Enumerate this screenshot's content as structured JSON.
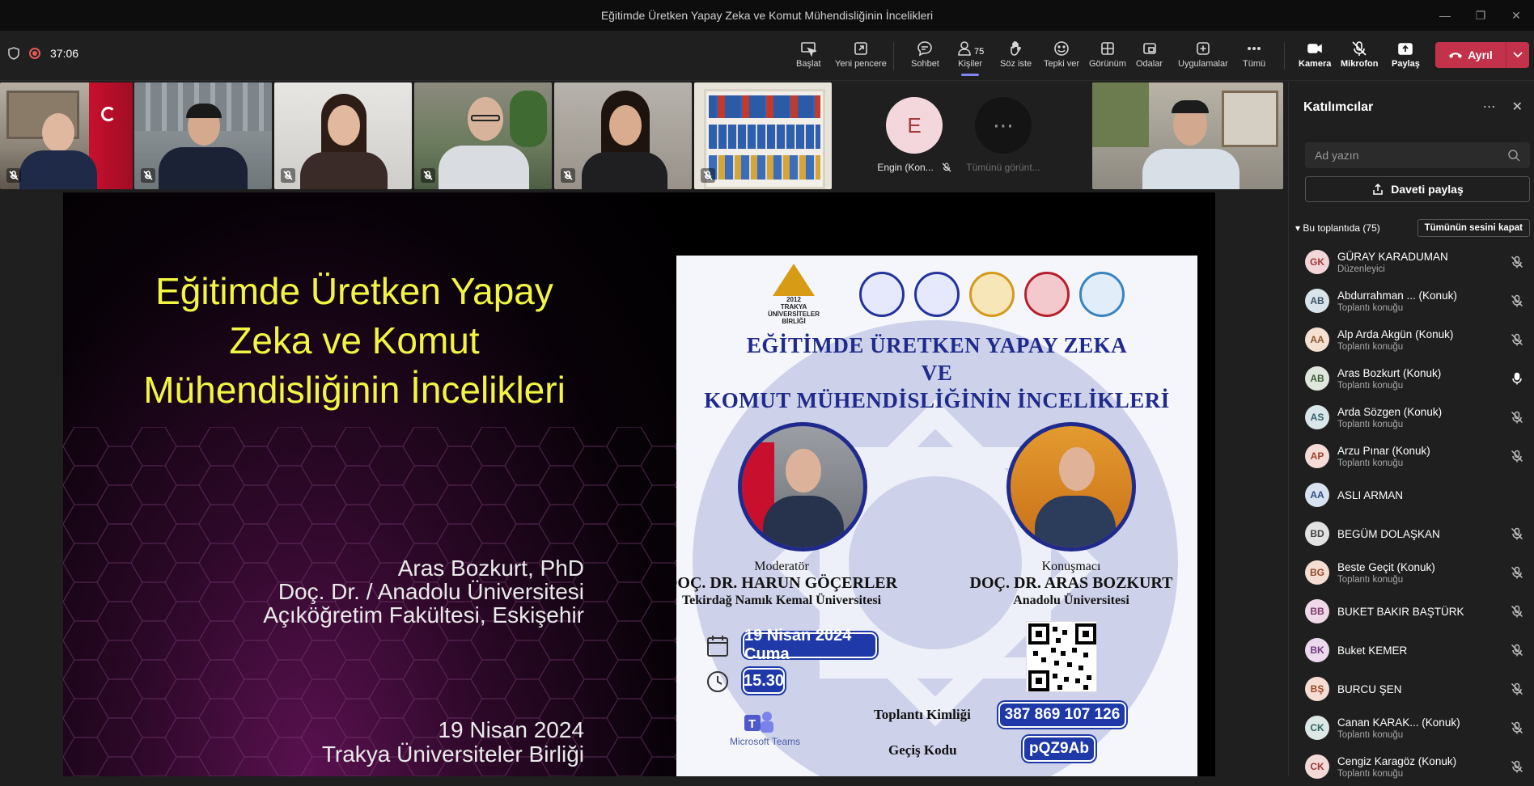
{
  "window": {
    "title": "Eğitimde Üretken Yapay Zeka ve Komut Mühendisliğinin İncelikleri"
  },
  "meeting": {
    "timer": "37:06"
  },
  "toolbar": {
    "items": [
      {
        "label": "Başlat",
        "icon": "present-cursor-icon"
      },
      {
        "label": "Yeni pencere",
        "icon": "new-window-icon"
      },
      {
        "label": "Sohbet",
        "icon": "chat-icon"
      },
      {
        "label": "Kişiler",
        "icon": "people-icon",
        "count": "75"
      },
      {
        "label": "Söz iste",
        "icon": "raise-hand-icon"
      },
      {
        "label": "Tepki ver",
        "icon": "react-emoji-icon"
      },
      {
        "label": "Görünüm",
        "icon": "view-grid-icon"
      },
      {
        "label": "Odalar",
        "icon": "rooms-icon"
      },
      {
        "label": "Uygulamalar",
        "icon": "apps-plus-icon"
      },
      {
        "label": "Tümü",
        "icon": "more-icon"
      },
      {
        "label": "Kamera",
        "icon": "camera-icon"
      },
      {
        "label": "Mikrofon",
        "icon": "mic-off-icon"
      },
      {
        "label": "Paylaş",
        "icon": "share-icon"
      }
    ],
    "leave_label": "Ayrıl"
  },
  "strip": {
    "avatar_tile": {
      "initial": "E",
      "name": "Engin (Kon..."
    },
    "more_tile": {
      "label": "Tümünü görünt..."
    }
  },
  "slide": {
    "title": "Eğitimde Üretken Yapay Zeka ve Komut Mühendisliğinin İncelikleri",
    "author_lines": [
      "Aras Bozkurt, PhD",
      "Doç. Dr. / Anadolu Üniversitesi",
      "Açıköğretim Fakültesi, Eskişehir"
    ],
    "date_lines": [
      "19 Nisan 2024",
      "Trakya Üniversiteler Birliği"
    ]
  },
  "poster": {
    "union_label": "TRAKYA ÜNİVERSİTELER BİRLİĞİ",
    "union_year": "2012",
    "title_lines": [
      "EĞİTİMDE ÜRETKEN YAPAY ZEKA",
      "VE",
      "KOMUT MÜHENDİSLİĞİNİN İNCELİKLERİ"
    ],
    "moderator": {
      "role": "Moderatör",
      "name": "DOÇ. DR. HARUN GÖÇERLER",
      "uni": "Tekirdağ Namık Kemal Üniversitesi"
    },
    "speaker": {
      "role": "Konuşmacı",
      "name": "DOÇ. DR. ARAS BOZKURT",
      "uni": "Anadolu Üniversitesi"
    },
    "date": "19 Nisan 2024 Cuma",
    "time": "15.30",
    "meeting_id_label": "Toplantı Kimliği",
    "meeting_id": "387 869 107 126",
    "passcode_label": "Geçiş Kodu",
    "passcode": "pQZ9Ab",
    "teams_label": "Microsoft Teams"
  },
  "panel": {
    "title": "Katılımcılar",
    "search_placeholder": "Ad yazın",
    "invite_label": "Daveti paylaş",
    "section_label": "Bu toplantıda (75)",
    "mute_all_label": "Tümünün sesini kapat",
    "participants": [
      {
        "initials": "GK",
        "name": "GÜRAY KARADUMAN",
        "role": "Düzenleyici",
        "color": "#f3d6d8",
        "fg": "#a4373a",
        "mic": "off"
      },
      {
        "initials": "AB",
        "name": "Abdurrahman ...  (Konuk)",
        "role": "Toplantı konuğu",
        "color": "#d9e3ea",
        "fg": "#3b5466",
        "mic": "off"
      },
      {
        "initials": "AA",
        "name": "Alp Arda Akgün (Konuk)",
        "role": "Toplantı konuğu",
        "color": "#f4e1d2",
        "fg": "#8a5a2f",
        "mic": "off"
      },
      {
        "initials": "AB",
        "name": "Aras Bozkurt (Konuk)",
        "role": "Toplantı konuğu",
        "color": "#dfe7dc",
        "fg": "#3f5b39",
        "mic": "on"
      },
      {
        "initials": "AS",
        "name": "Arda Sözgen (Konuk)",
        "role": "Toplantı konuğu",
        "color": "#d9e6ea",
        "fg": "#31606b",
        "mic": "off"
      },
      {
        "initials": "AP",
        "name": "Arzu Pınar (Konuk)",
        "role": "Toplantı konuğu",
        "color": "#f6dcd6",
        "fg": "#9b3f2d",
        "mic": "off"
      },
      {
        "initials": "AA",
        "name": "ASLI ARMAN",
        "role": "",
        "color": "#d8e2f0",
        "fg": "#2f4d7c",
        "mic": "none"
      },
      {
        "initials": "BD",
        "name": "BEGÜM DOLAŞKAN",
        "role": "",
        "color": "#e2e2e2",
        "fg": "#444444",
        "mic": "off"
      },
      {
        "initials": "BG",
        "name": "Beste Geçit (Konuk)",
        "role": "Toplantı konuğu",
        "color": "#f4ddd3",
        "fg": "#8f4a2b",
        "mic": "off"
      },
      {
        "initials": "BB",
        "name": "BUKET BAKIR BAŞTÜRK",
        "role": "",
        "color": "#efd9e9",
        "fg": "#7d3a6c",
        "mic": "off"
      },
      {
        "initials": "BK",
        "name": "Buket KEMER",
        "role": "",
        "color": "#ecd9ee",
        "fg": "#6d3a7a",
        "mic": "off"
      },
      {
        "initials": "BŞ",
        "name": "BURCU ŞEN",
        "role": "",
        "color": "#f6ddd4",
        "fg": "#9a442a",
        "mic": "off"
      },
      {
        "initials": "CK",
        "name": "Canan KARAK...  (Konuk)",
        "role": "Toplantı konuğu",
        "color": "#dce8e6",
        "fg": "#2f6660",
        "mic": "off"
      },
      {
        "initials": "CK",
        "name": "Cengiz Karagöz (Konuk)",
        "role": "Toplantı konuğu",
        "color": "#f4d9d9",
        "fg": "#953838",
        "mic": "off"
      }
    ]
  }
}
